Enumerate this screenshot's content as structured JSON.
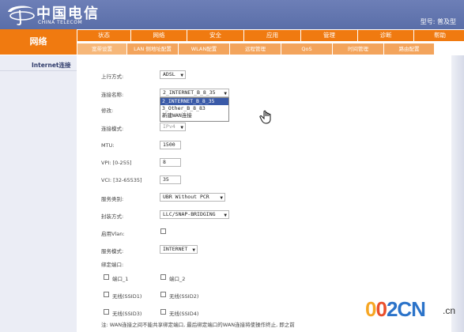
{
  "header": {
    "logo_cn": "中国电信",
    "logo_en": "CHINA TELECOM",
    "model": "型号: 普及型"
  },
  "nav": {
    "section_title": "网络",
    "main_tabs": [
      "状态",
      "网络",
      "安全",
      "应用",
      "管理",
      "诊断",
      "帮助"
    ],
    "sub_tabs": [
      "宽带设置",
      "LAN 侧地址配置",
      "WLAN配置",
      "远程管理",
      "QoS",
      "时间管理",
      "路由配置"
    ]
  },
  "sidebar": {
    "items": [
      "Internet连接"
    ]
  },
  "form": {
    "uplink_label": "上行方式:",
    "uplink_value": "ADSL",
    "conn_name_label": "连接名称:",
    "conn_name_value": "2_INTERNET_B_8_35",
    "modify_label": "修改:",
    "conn_mode_label": "连接模式:",
    "conn_mode_value": "IPv4",
    "mtu_label": "MTU:",
    "mtu_value": "1500",
    "vpi_label": "VPI: [0-255]",
    "vpi_value": "8",
    "vci_label": "VCI: [32-65535]",
    "vci_value": "35",
    "service_type_label": "服务类别:",
    "service_type_value": "UBR Without PCR",
    "encap_label": "封装方式:",
    "encap_value": "LLC/SNAP-BRIDGING",
    "vlan_label": "启用Vlan:",
    "service_mode_label": "服务模式:",
    "service_mode_value": "INTERNET",
    "bind_port_label": "绑定端口:",
    "ports": [
      "端口_1",
      "端口_2",
      "无线(SSID1)",
      "无线(SSID2)",
      "无线(SSID3)",
      "无线(SSID4)"
    ],
    "note": "注: WAN连接之间不能共享绑定端口, 最后绑定端口的WAN连接将使操作终止, 即之前"
  },
  "dropdown": {
    "options": [
      "2_INTERNET_B_8_35",
      "3_Other_B_8_83",
      "新建WAN连接"
    ],
    "highlighted_index": 0
  },
  "watermark": {
    "text": "002CN",
    "suffix": ".cn"
  },
  "colors": {
    "header_bg": "#6d7fb7",
    "tab_orange": "#f07a10",
    "subtab_orange": "#f3a45c",
    "sidebar_bg": "#ebedf5"
  }
}
